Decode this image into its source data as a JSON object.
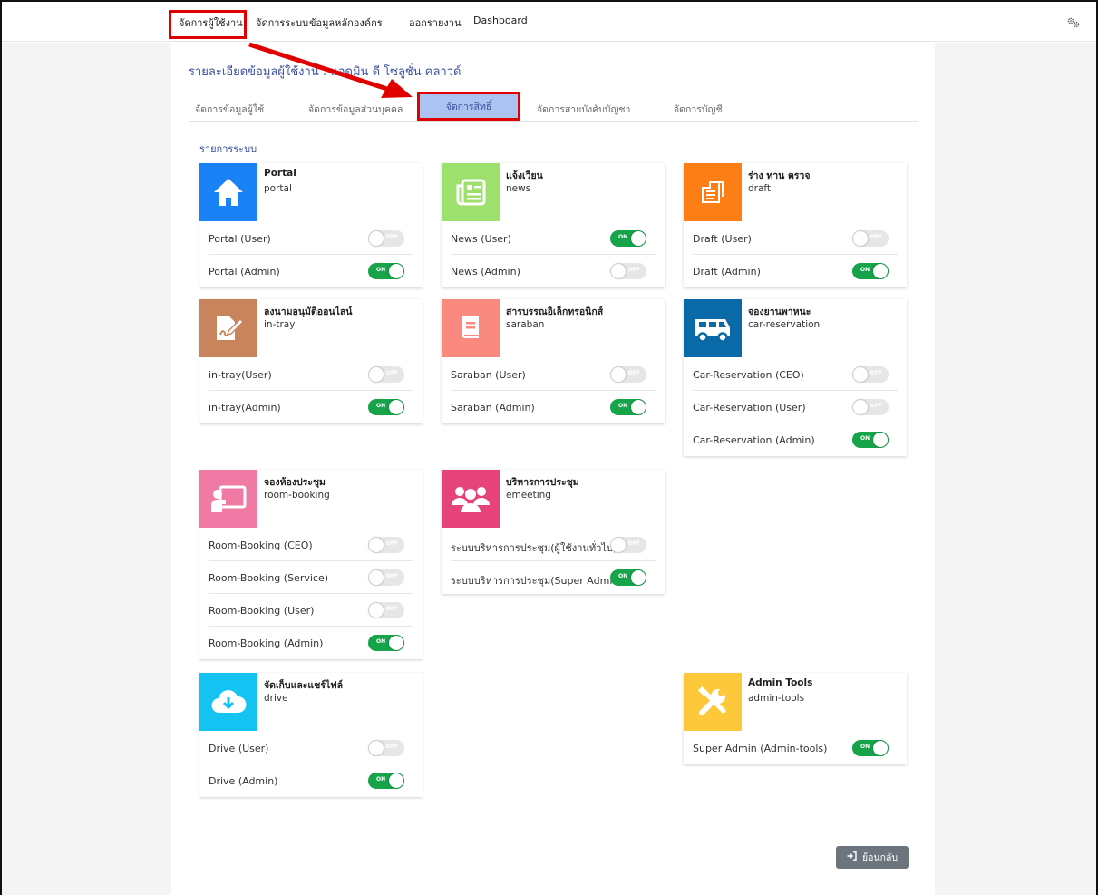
{
  "nav": {
    "items": [
      "จัดการผู้ใช้งาน",
      "จัดการระบบ",
      "ข้อมูลหลักองค์กร",
      "ออกรายงาน",
      "Dashboard"
    ],
    "settings_icon": "gears-icon"
  },
  "page": {
    "title": "รายละเอียดข้อมูลผู้ใช้งาน : แอดมิน ดี โซลูชั่น คลาวด์"
  },
  "tabs": [
    "จัดการข้อมูลผู้ใช้",
    "จัดการข้อมูลส่วนบุคคล",
    "จัดการสิทธิ์",
    "จัดการสายบังคับบัญชา",
    "จัดการบัญชี"
  ],
  "active_tab": 2,
  "section_title": "รายการระบบ",
  "toggle_text": {
    "on": "ON",
    "off": "OFF"
  },
  "systems": [
    {
      "name": "Portal",
      "code": "portal",
      "icon": "home-icon",
      "color": "#1a82f7",
      "perms": [
        {
          "label": "Portal (User)",
          "on": false
        },
        {
          "label": "Portal (Admin)",
          "on": true
        }
      ]
    },
    {
      "name": "แจ้งเวียน",
      "code": "news",
      "icon": "newspaper-icon",
      "color": "#9ee06e",
      "perms": [
        {
          "label": "News (User)",
          "on": true
        },
        {
          "label": "News (Admin)",
          "on": false
        }
      ]
    },
    {
      "name": "ร่าง ทาน ตรวจ",
      "code": "draft",
      "icon": "draft-icon",
      "color": "#fd7e14",
      "perms": [
        {
          "label": "Draft (User)",
          "on": false
        },
        {
          "label": "Draft (Admin)",
          "on": true
        }
      ]
    },
    {
      "name": "ลงนามอนุมัติออนไลน์",
      "code": "in-tray",
      "icon": "signature-icon",
      "color": "#c8845c",
      "perms": [
        {
          "label": "in-tray(User)",
          "on": false
        },
        {
          "label": "in-tray(Admin)",
          "on": true
        }
      ]
    },
    {
      "name": "สารบรรณอิเล็กทรอนิกส์",
      "code": "saraban",
      "icon": "book-icon",
      "color": "#fa8a80",
      "perms": [
        {
          "label": "Saraban (User)",
          "on": false
        },
        {
          "label": "Saraban (Admin)",
          "on": true
        }
      ]
    },
    {
      "name": "จองยานพาหนะ",
      "code": "car-reservation",
      "icon": "van-icon",
      "color": "#0a6aa8",
      "perms": [
        {
          "label": "Car-Reservation (CEO)",
          "on": false
        },
        {
          "label": "Car-Reservation (User)",
          "on": false
        },
        {
          "label": "Car-Reservation (Admin)",
          "on": true
        }
      ]
    },
    {
      "name": "จองห้องประชุม",
      "code": "room-booking",
      "icon": "presentation-icon",
      "color": "#ef7aa3",
      "perms": [
        {
          "label": "Room-Booking (CEO)",
          "on": false
        },
        {
          "label": "Room-Booking (Service)",
          "on": false
        },
        {
          "label": "Room-Booking (User)",
          "on": false
        },
        {
          "label": "Room-Booking (Admin)",
          "on": true
        }
      ]
    },
    {
      "name": "บริหารการประชุม",
      "code": "emeeting",
      "icon": "users-icon",
      "color": "#e6437a",
      "perms": [
        {
          "label": "ระบบบริหารการประชุม(ผู้ใช้งานทั่วไป)",
          "on": false
        },
        {
          "label": "ระบบบริหารการประชุม(Super Admin)",
          "on": true
        }
      ]
    },
    {
      "name": "จัดเก็บและแชร์ไฟล์",
      "code": "drive",
      "icon": "cloud-download-icon",
      "color": "#15c3f2",
      "perms": [
        {
          "label": "Drive (User)",
          "on": false
        },
        {
          "label": "Drive (Admin)",
          "on": true
        }
      ]
    },
    {
      "name": "Admin Tools",
      "code": "admin-tools",
      "icon": "tools-icon",
      "color": "#fdc93a",
      "perms": [
        {
          "label": "Super Admin (Admin-tools)",
          "on": true
        }
      ]
    }
  ],
  "back_button": "ย้อนกลับ"
}
